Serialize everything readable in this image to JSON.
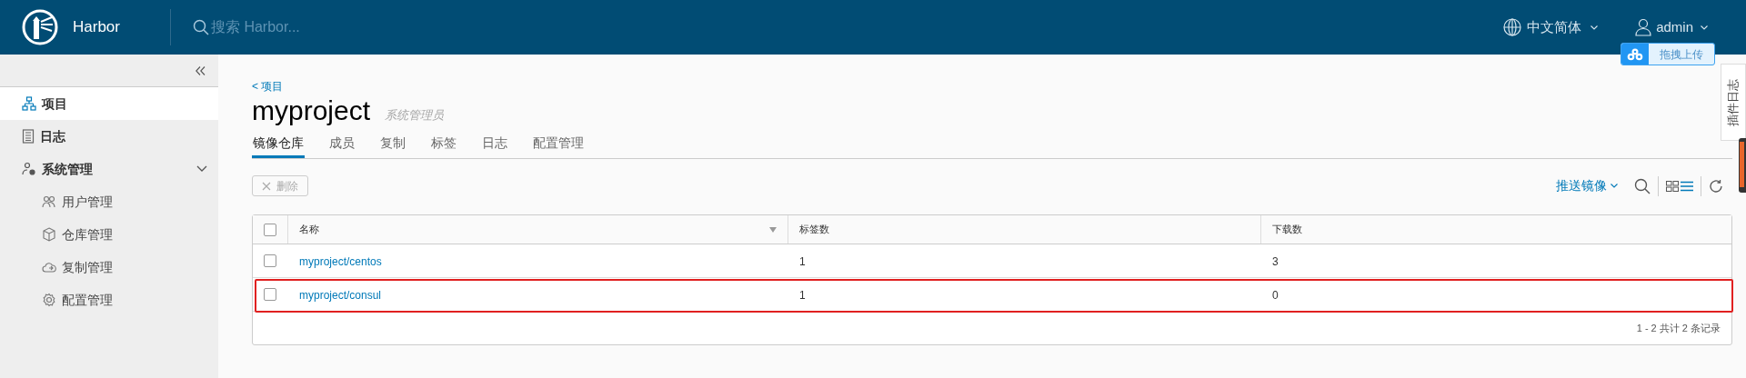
{
  "header": {
    "brand": "Harbor",
    "search": {
      "placeholder": "搜索 Harbor..."
    },
    "language": "中文简体",
    "user": "admin"
  },
  "upload_widget": {
    "label": "拖拽上传"
  },
  "side_tab": {
    "label": "插件日志"
  },
  "sidebar": {
    "items": [
      {
        "label": "项目",
        "selected": true
      },
      {
        "label": "日志",
        "selected": false
      },
      {
        "label": "系统管理",
        "selected": false,
        "expanded": true,
        "children": [
          {
            "label": "用户管理",
            "selected": false
          },
          {
            "label": "仓库管理",
            "selected": false
          },
          {
            "label": "复制管理",
            "selected": false
          },
          {
            "label": "配置管理",
            "selected": false
          }
        ]
      }
    ]
  },
  "breadcrumb": "< 项目",
  "project": {
    "name": "myproject",
    "role": "系统管理员"
  },
  "tabs": [
    {
      "label": "镜像仓库",
      "selected": true
    },
    {
      "label": "成员",
      "selected": false
    },
    {
      "label": "复制",
      "selected": false
    },
    {
      "label": "标签",
      "selected": false
    },
    {
      "label": "日志",
      "selected": false
    },
    {
      "label": "配置管理",
      "selected": false
    }
  ],
  "toolbar": {
    "delete": {
      "label": "删除",
      "disabled": true
    },
    "push": "推送镜像"
  },
  "table": {
    "all_checked": false,
    "columns": [
      "名称",
      "标签数",
      "下载数"
    ],
    "rows": [
      {
        "cells": [
          "myproject/centos",
          "1",
          "3"
        ],
        "checked": false,
        "highlighted": false
      },
      {
        "cells": [
          "myproject/consul",
          "1",
          "0"
        ],
        "checked": false,
        "highlighted": true
      }
    ],
    "footer": "1 - 2 共计 2 条记录"
  }
}
